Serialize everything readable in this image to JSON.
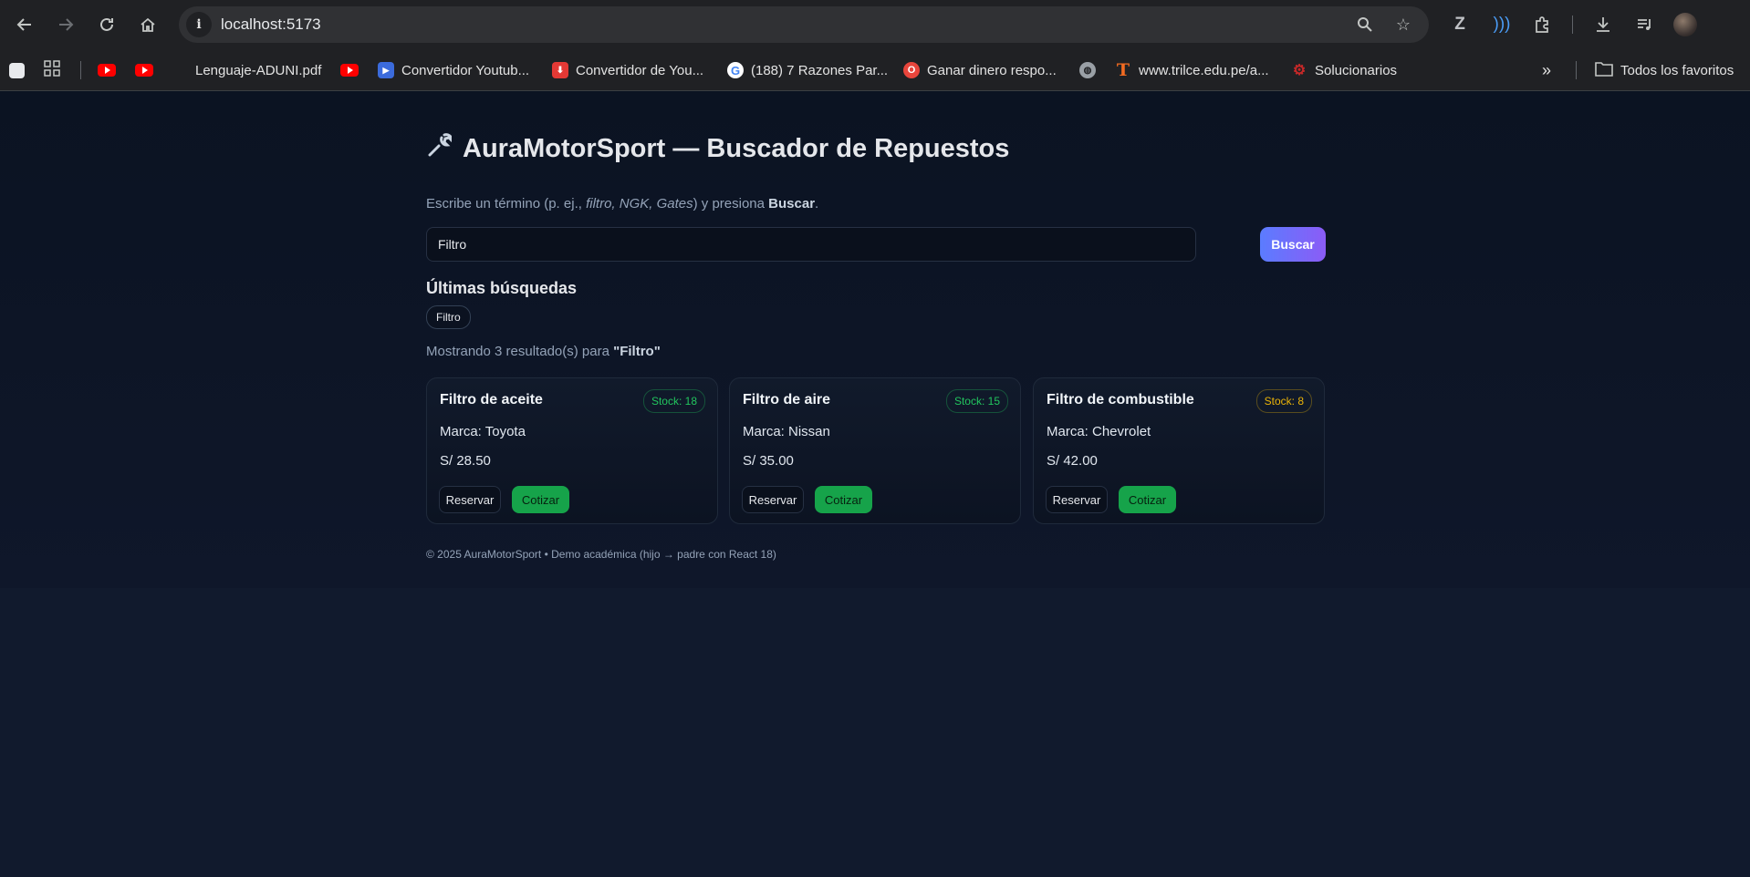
{
  "browser": {
    "url": "localhost:5173",
    "bookmarks": [
      {
        "label": "",
        "icon": "apps-icon"
      },
      {
        "label": "",
        "icon": "youtube-icon"
      },
      {
        "label": "",
        "icon": "youtube-icon"
      },
      {
        "label": "Lenguaje-ADUNI.pdf",
        "icon": "youtube-icon"
      },
      {
        "label": "Convertidor Youtub...",
        "icon": "converter-icon"
      },
      {
        "label": "Convertidor de You...",
        "icon": "download-icon"
      },
      {
        "label": "(188) 7 Razones Par...",
        "icon": "google-icon"
      },
      {
        "label": "Ganar dinero respo...",
        "icon": "opera-icon"
      },
      {
        "label": "",
        "icon": "globe-icon"
      },
      {
        "label": "www.trilce.edu.pe/a...",
        "icon": "trilce-icon"
      },
      {
        "label": "Solucionarios",
        "icon": "gear-icon"
      }
    ],
    "all_bookmarks": "Todos los favoritos",
    "more": "»"
  },
  "app": {
    "title": "AuraMotorSport — Buscador de Repuestos",
    "hint": {
      "prefix": "Escribe un término (p. ej., ",
      "examples": "filtro, NGK, Gates",
      "middle": ") y presiona ",
      "action": "Buscar",
      "suffix": "."
    },
    "search": {
      "value": "Filtro",
      "button": "Buscar"
    },
    "recent": {
      "heading": "Últimas búsquedas",
      "items": [
        "Filtro"
      ]
    },
    "results": {
      "prefix": "Mostrando 3 resultado(s) para ",
      "query": "\"Filtro\"",
      "items": [
        {
          "name": "Filtro de aceite",
          "stock": "Stock: 18",
          "brand": "Marca: Toyota",
          "price": "S/ 28.50",
          "stock_color": "#22c55e"
        },
        {
          "name": "Filtro de aire",
          "stock": "Stock: 15",
          "brand": "Marca: Nissan",
          "price": "S/ 35.00",
          "stock_color": "#22c55e"
        },
        {
          "name": "Filtro de combustible",
          "stock": "Stock: 8",
          "brand": "Marca: Chevrolet",
          "price": "S/ 42.00",
          "stock_color": "#eab308"
        }
      ],
      "reserve_label": "Reservar",
      "quote_label": "Cotizar"
    },
    "footer": "© 2025 AuraMotorSport • Demo académica (hijo → padre con React 18)"
  },
  "colors": {
    "accent_from": "#5b7cff",
    "accent_to": "#8b5cf6",
    "quote": "#16a34a",
    "background": "#0d1424"
  }
}
